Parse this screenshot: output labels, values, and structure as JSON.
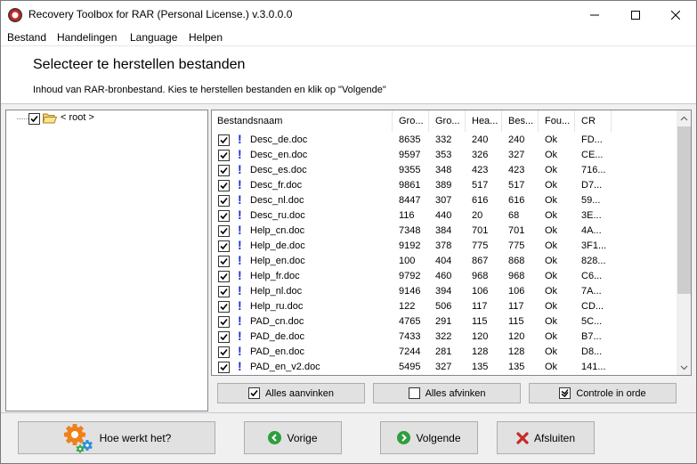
{
  "window": {
    "title": "Recovery Toolbox for RAR (Personal License.) v.3.0.0.0"
  },
  "menu": [
    "Bestand",
    "Handelingen",
    "Language",
    "Helpen"
  ],
  "header": {
    "title": "Selecteer te herstellen bestanden",
    "subtitle": "Inhoud van RAR-bronbestand. Kies te herstellen bestanden en klik op \"Volgende\""
  },
  "tree": {
    "root_label": "< root >",
    "root_checked": true
  },
  "table": {
    "columns": [
      "Bestandsnaam",
      "Gro...",
      "Gro...",
      "Hea...",
      "Bes...",
      "Fou...",
      "CR"
    ],
    "rows": [
      {
        "checked": true,
        "name": "Desc_de.doc",
        "c1": "8635",
        "c2": "332",
        "c3": "240",
        "c4": "240",
        "c5": "Ok",
        "c6": "FD..."
      },
      {
        "checked": true,
        "name": "Desc_en.doc",
        "c1": "9597",
        "c2": "353",
        "c3": "326",
        "c4": "327",
        "c5": "Ok",
        "c6": "CE..."
      },
      {
        "checked": true,
        "name": "Desc_es.doc",
        "c1": "9355",
        "c2": "348",
        "c3": "423",
        "c4": "423",
        "c5": "Ok",
        "c6": "716..."
      },
      {
        "checked": true,
        "name": "Desc_fr.doc",
        "c1": "9861",
        "c2": "389",
        "c3": "517",
        "c4": "517",
        "c5": "Ok",
        "c6": "D7..."
      },
      {
        "checked": true,
        "name": "Desc_nl.doc",
        "c1": "8447",
        "c2": "307",
        "c3": "616",
        "c4": "616",
        "c5": "Ok",
        "c6": "59..."
      },
      {
        "checked": true,
        "name": "Desc_ru.doc",
        "c1": "116",
        "c2": "440",
        "c3": "20",
        "c4": "68",
        "c5": "Ok",
        "c6": "3E..."
      },
      {
        "checked": true,
        "name": "Help_cn.doc",
        "c1": "7348",
        "c2": "384",
        "c3": "701",
        "c4": "701",
        "c5": "Ok",
        "c6": "4A..."
      },
      {
        "checked": true,
        "name": "Help_de.doc",
        "c1": "9192",
        "c2": "378",
        "c3": "775",
        "c4": "775",
        "c5": "Ok",
        "c6": "3F1..."
      },
      {
        "checked": true,
        "name": "Help_en.doc",
        "c1": "100",
        "c2": "404",
        "c3": "867",
        "c4": "868",
        "c5": "Ok",
        "c6": "828..."
      },
      {
        "checked": true,
        "name": "Help_fr.doc",
        "c1": "9792",
        "c2": "460",
        "c3": "968",
        "c4": "968",
        "c5": "Ok",
        "c6": "C6..."
      },
      {
        "checked": true,
        "name": "Help_nl.doc",
        "c1": "9146",
        "c2": "394",
        "c3": "106",
        "c4": "106",
        "c5": "Ok",
        "c6": "7A..."
      },
      {
        "checked": true,
        "name": "Help_ru.doc",
        "c1": "122",
        "c2": "506",
        "c3": "117",
        "c4": "117",
        "c5": "Ok",
        "c6": "CD..."
      },
      {
        "checked": true,
        "name": "PAD_cn.doc",
        "c1": "4765",
        "c2": "291",
        "c3": "115",
        "c4": "115",
        "c5": "Ok",
        "c6": "5C..."
      },
      {
        "checked": true,
        "name": "PAD_de.doc",
        "c1": "7433",
        "c2": "322",
        "c3": "120",
        "c4": "120",
        "c5": "Ok",
        "c6": "B7..."
      },
      {
        "checked": true,
        "name": "PAD_en.doc",
        "c1": "7244",
        "c2": "281",
        "c3": "128",
        "c4": "128",
        "c5": "Ok",
        "c6": "D8..."
      },
      {
        "checked": true,
        "name": "PAD_en_v2.doc",
        "c1": "5495",
        "c2": "327",
        "c3": "135",
        "c4": "135",
        "c5": "Ok",
        "c6": "141..."
      }
    ]
  },
  "buttons": {
    "check_all": "Alles aanvinken",
    "uncheck_all": "Alles afvinken",
    "check_ok": "Controle in orde",
    "how": "Hoe werkt het?",
    "prev": "Vorige",
    "next": "Volgende",
    "close": "Afsluiten"
  },
  "colors": {
    "accent_blue": "#1a2fd6",
    "green": "#2e9e3e",
    "red": "#c62a2a",
    "gear_orange": "#f0801a"
  },
  "icons": {
    "row_status": "exclamation-icon",
    "tree_folder": "folder-icon",
    "how": "gears-icon",
    "prev": "arrow-left-icon",
    "next": "arrow-right-icon",
    "close": "x-icon"
  }
}
